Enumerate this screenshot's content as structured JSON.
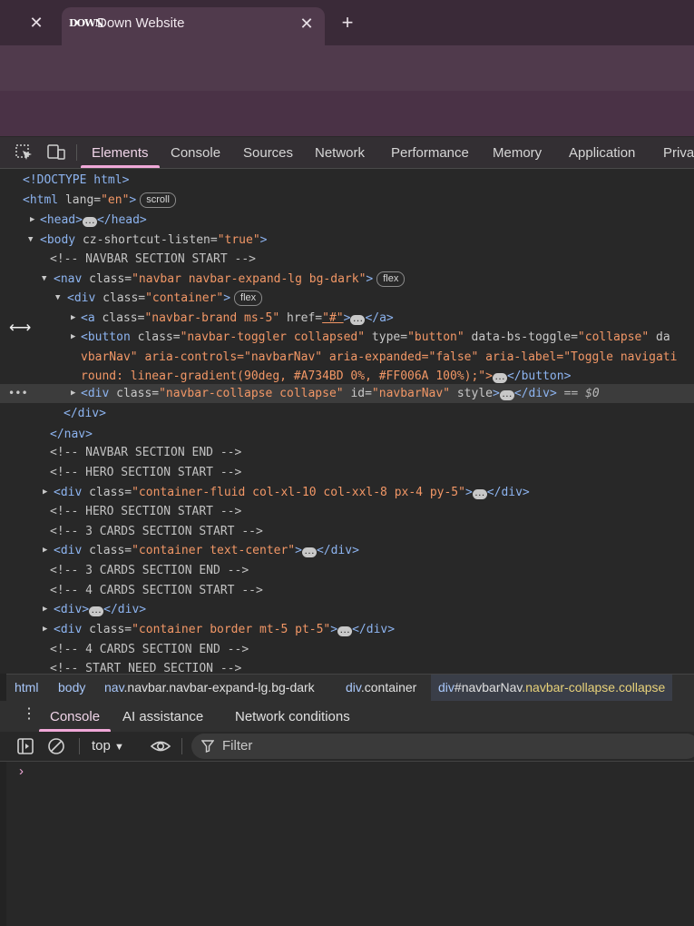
{
  "browser": {
    "tab_title": "Down Website",
    "favicon_text": "DOWN",
    "prev_tab_close": "✕",
    "tab_close": "✕",
    "new_tab": "+"
  },
  "devtools": {
    "tabs": [
      "Elements",
      "Console",
      "Sources",
      "Network",
      "Performance",
      "Memory",
      "Application",
      "Privacy"
    ],
    "active_tab": "Elements"
  },
  "dom_tree": {
    "doctype": "<!DOCTYPE html>",
    "html_open": "<html",
    "html_attr": "lang",
    "html_val": "\"en\"",
    "scroll_badge": "scroll",
    "head_open": "<head>",
    "head_close": "</head>",
    "body_open": "<body",
    "body_attr": "cz-shortcut-listen",
    "body_val": "\"true\"",
    "comment_navbar_start": "<!-- NAVBAR SECTION START           -->",
    "nav_attr_val": "\"navbar navbar-expand-lg bg-dark\"",
    "flex_badge": "flex",
    "div_container_val": "\"container\"",
    "a_class_val": "\"navbar-brand ms-5\"",
    "a_href_val": "\"#\"",
    "button_class_val": "\"navbar-toggler collapsed\"",
    "button_type_val": "\"button\"",
    "button_toggle_val": "\"collapse\"",
    "button_line2": "vbarNav\" aria-controls=\"navbarNav\" aria-expanded=\"false\" aria-label=\"Toggle navigati",
    "button_line3": "round: linear-gradient(90deg, #A734BD 0%, #FF006A 100%);\">",
    "collapse_class_val": "\"navbar-collapse collapse\"",
    "collapse_id_val": "\"navbarNav\"",
    "selected_marker": "== $0",
    "div_close": "</div>",
    "nav_close": "</nav>",
    "comment_navbar_end": "<!-- NAVBAR SECTION END           -->",
    "comment_hero_start": "<!-- HERO SECTION START -->",
    "hero_div_val": "\"container-fluid col-xl-10 col-xxl-8 px-4 py-5\"",
    "comment_hero_end": "<!-- HERO SECTION START -->",
    "comment_3cards_start": "<!-- 3 CARDS SECTION START -->",
    "cards3_div_val": "\"container text-center\"",
    "comment_3cards_end": "<!-- 3 CARDS SECTION END -->",
    "comment_4cards_start": "<!-- 4 CARDS SECTION START -->",
    "plain_div_open": "<div>",
    "border_div_val": "\"container border mt-5 pt-5\"",
    "comment_4cards_end": "<!-- 4 CARDS SECTION END -->",
    "comment_need_start": "<!-- START NEED SECTION         -->"
  },
  "breadcrumb": [
    {
      "tag": "html",
      "id": "",
      "cls": ""
    },
    {
      "tag": "body",
      "id": "",
      "cls": ""
    },
    {
      "tag": "nav",
      "id": "",
      "cls": ".navbar.navbar-expand-lg.bg-dark"
    },
    {
      "tag": "div",
      "id": "",
      "cls": ".container"
    },
    {
      "tag": "div",
      "id": "#navbarNav",
      "cls": ".navbar-collapse.collapse"
    }
  ],
  "drawer": {
    "tabs": [
      "Console",
      "AI assistance",
      "Network conditions"
    ],
    "active_tab": "Console"
  },
  "console": {
    "context": "top",
    "filter_placeholder": "Filter",
    "prompt": "›"
  },
  "colors": {
    "accent": "#f0a8d8",
    "tag": "#8db4f0",
    "attr_value": "#f29766"
  }
}
